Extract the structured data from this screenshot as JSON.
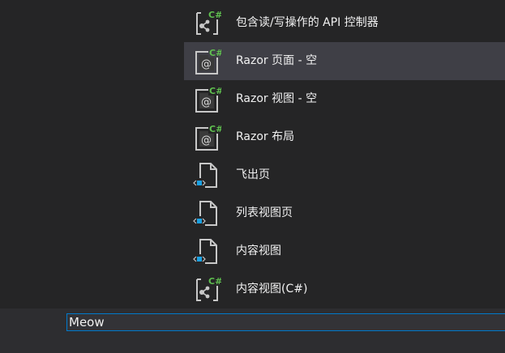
{
  "templates": [
    {
      "label": "包含读/写操作的 API 控制器",
      "icon": "csharp-class-icon",
      "badge": "C#"
    },
    {
      "label": "Razor 页面 - 空",
      "icon": "razor-page-icon",
      "badge": "C#"
    },
    {
      "label": "Razor 视图 - 空",
      "icon": "razor-view-icon",
      "badge": "C#"
    },
    {
      "label": "Razor 布局",
      "icon": "razor-layout-icon",
      "badge": "C#"
    },
    {
      "label": "飞出页",
      "icon": "xaml-page-icon"
    },
    {
      "label": "列表视图页",
      "icon": "xaml-page-icon"
    },
    {
      "label": "内容视图",
      "icon": "xaml-page-icon"
    },
    {
      "label": "内容视图(C#)",
      "icon": "csharp-class-icon",
      "badge": "C#"
    }
  ],
  "selected_index": 1,
  "name_field": {
    "value": "Meow"
  },
  "colors": {
    "background": "#252526",
    "selected": "#3f3f46",
    "text": "#f1f1f1",
    "accent_green": "#388a34",
    "accent_blue": "#1ba1e2",
    "input_border": "#007acc"
  }
}
